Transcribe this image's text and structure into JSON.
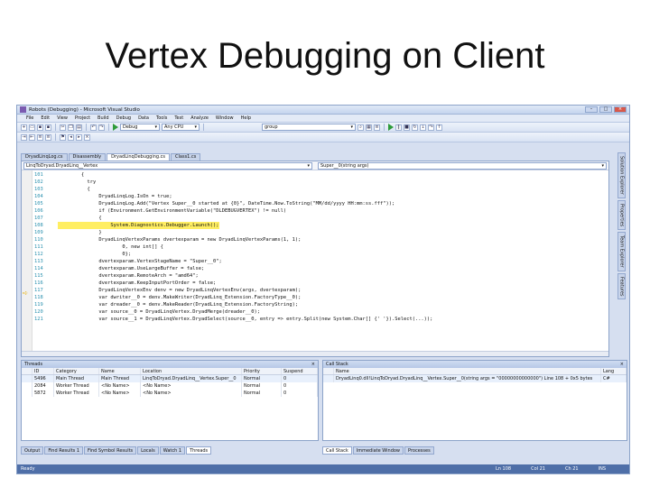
{
  "slide_title": "Vertex Debugging on Client",
  "window": {
    "title": "Robots (Debugging) - Microsoft Visual Studio",
    "menu": [
      "File",
      "Edit",
      "View",
      "Project",
      "Build",
      "Debug",
      "Data",
      "Tools",
      "Test",
      "Analyze",
      "Window",
      "Help"
    ],
    "config_combo": "Debug",
    "platform_combo": "Any CPU",
    "find_combo": "group"
  },
  "doc_tabs": [
    "DryadLinqLog.cs",
    "Disassembly",
    "DryadLinqDebugging.cs",
    "Class1.cs"
  ],
  "nav": {
    "left": "LinqToDryad.DryadLinq__Vertex",
    "right": "Super__0(string args)"
  },
  "code_lines": [
    {
      "n": "101",
      "t": "        {"
    },
    {
      "n": "102",
      "t": "          try"
    },
    {
      "n": "103",
      "t": "          {"
    },
    {
      "n": "104",
      "t": "              DryadLinqLog.IsOn = true;"
    },
    {
      "n": "105",
      "t": "              DryadLinqLog.Add(\"Vertex Super__0 started at {0}\", DateTime.Now.ToString(\"MM/dd/yyyy HH:mm:ss.fff\"));"
    },
    {
      "n": "106",
      "t": "              if (Environment.GetEnvironmentVariable(\"DLDEBUGVERTEX\") != null)"
    },
    {
      "n": "107",
      "t": "              {"
    },
    {
      "n": "108",
      "t": "                  System.Diagnostics.Debugger.Launch();"
    },
    {
      "n": "109",
      "t": "              }"
    },
    {
      "n": "110",
      "t": "              DryadLinqVertexParams dvertexparam = new DryadLinqVertexParams(1, 1);"
    },
    {
      "n": "111",
      "t": "                      0, new int[] {"
    },
    {
      "n": "112",
      "t": "                      0};"
    },
    {
      "n": "113",
      "t": "              dvertexparam.VertexStageName = \"Super__0\";"
    },
    {
      "n": "114",
      "t": "              dvertexparam.UseLargeBuffer = false;"
    },
    {
      "n": "115",
      "t": "              dvertexparam.RemoteArch = \"amd64\";"
    },
    {
      "n": "116",
      "t": "              dvertexparam.KeepInputPortOrder = false;"
    },
    {
      "n": "117",
      "t": "              DryadLinqVertexEnv denv = new DryadLinqVertexEnv(args, dvertexparam);"
    },
    {
      "n": "118",
      "t": "              var dwriter__0 = denv.MakeWriter(DryadLinq_Extension.FactoryType__0);"
    },
    {
      "n": "119",
      "t": "              var dreader__0 = denv.MakeReader(DryadLinq_Extension.FactoryString);"
    },
    {
      "n": "120",
      "t": "              var source__0 = DryadLinqVertex.DryadMerge(dreader__0);"
    },
    {
      "n": "121",
      "t": "              var source__1 = DryadLinqVertex.DryadSelect(source__0, entry => entry.Split(new System.Char[] {' '}).Select(...));"
    }
  ],
  "highlight_line": "108",
  "side_tabs": [
    "Solution Explorer",
    "Properties",
    "Team Explorer",
    "Features"
  ],
  "threads_panel": {
    "title": "Threads",
    "columns": [
      "",
      "ID",
      "Category",
      "Name",
      "Location",
      "Priority",
      "Suspend"
    ],
    "rows": [
      [
        "",
        "5496",
        "Main Thread",
        "Main Thread",
        "LinqToDryad.DryadLinq__Vertex.Super__0",
        "Normal",
        "0"
      ],
      [
        "",
        "2084",
        "Worker Thread",
        "<No Name>",
        "<No Name>",
        "Normal",
        "0"
      ],
      [
        "",
        "5872",
        "Worker Thread",
        "<No Name>",
        "<No Name>",
        "Normal",
        "0"
      ]
    ]
  },
  "callstack_panel": {
    "title": "Call Stack",
    "columns": [
      "",
      "Name",
      "Lang"
    ],
    "rows": [
      [
        "",
        "DryadLinq0.dll!LinqToDryad.DryadLinq__Vertex.Super__0(string args = \"00000000000000\") Line 108 + 0x5 bytes",
        "C#"
      ]
    ]
  },
  "bottom_tabs_left": [
    "Output",
    "Find Results 1",
    "Find Symbol Results",
    "Locals",
    "Watch 1",
    "Threads"
  ],
  "bottom_tabs_right": [
    "Call Stack",
    "Immediate Window",
    "Processes"
  ],
  "status": {
    "state": "Ready",
    "ln": "Ln 108",
    "col": "Col 21",
    "ch": "Ch 21",
    "mode": "INS"
  }
}
